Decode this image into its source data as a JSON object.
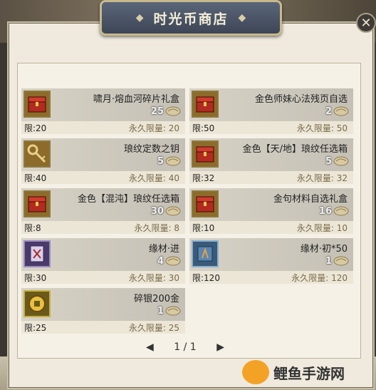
{
  "title": "时光币商店",
  "pager": {
    "text": "1 / 1"
  },
  "watermark": {
    "text": "鲤鱼手游网"
  },
  "items": [
    {
      "name": "啸月·熔血河碎片礼盒",
      "price": "25",
      "limit": "限:20",
      "perm": "永久限量: 20",
      "icon": "red-chest-icon",
      "color": "gold"
    },
    {
      "name": "金色师妹心法残页自选",
      "price": "2",
      "limit": "限:50",
      "perm": "永久限量: 50",
      "icon": "red-chest-icon",
      "color": "gold"
    },
    {
      "name": "琅纹定数之钥",
      "price": "5",
      "limit": "限:40",
      "perm": "永久限量: 40",
      "icon": "key-icon",
      "color": "gold"
    },
    {
      "name": "金色【天/地】琅纹任选箱",
      "price": "5",
      "limit": "限:32",
      "perm": "永久限量: 32",
      "icon": "red-chest-icon",
      "color": "gold"
    },
    {
      "name": "金色【混沌】琅纹任选箱",
      "price": "30",
      "limit": "限:8",
      "perm": "永久限量: 8",
      "icon": "red-chest-icon",
      "color": "gold"
    },
    {
      "name": "金句材料自选礼盒",
      "price": "16",
      "limit": "限:10",
      "perm": "永久限量: 10",
      "icon": "red-chest-icon",
      "color": "gold"
    },
    {
      "name": "缘材·进",
      "price": "4",
      "limit": "限:30",
      "perm": "永久限量: 30",
      "icon": "purple-token-icon",
      "color": "purple"
    },
    {
      "name": "缘材·初*50",
      "price": "1",
      "limit": "限:120",
      "perm": "永久限量: 120",
      "icon": "blue-token-icon",
      "color": "blue"
    },
    {
      "name": "碎银200金",
      "price": "1",
      "limit": "限:25",
      "perm": "永久限量: 25",
      "icon": "coin-icon",
      "color": "yellow"
    }
  ]
}
